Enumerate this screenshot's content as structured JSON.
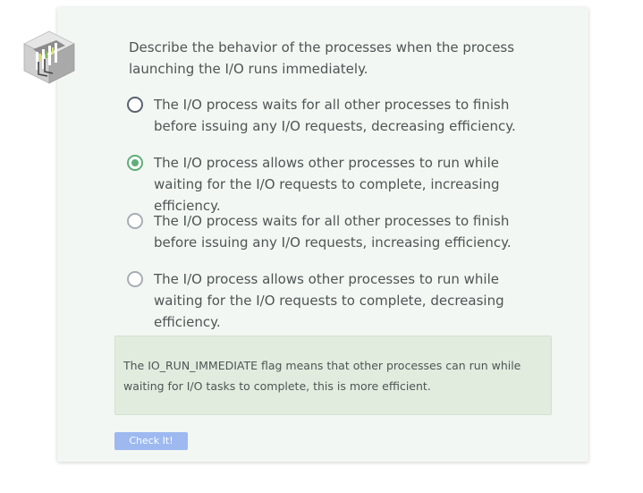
{
  "quiz": {
    "question": "Describe the behavior of the processes when the process launching the I/O runs immediately.",
    "options": [
      {
        "label": "The I/O process waits for all other processes to finish before issuing any I/O requests, decreasing efficiency.",
        "selected": false
      },
      {
        "label": "The I/O process allows other processes to run while waiting for the I/O requests to complete, increasing efficiency.",
        "selected": true
      },
      {
        "label": "The I/O process waits for all other processes to finish before issuing any I/O requests, increasing efficiency.",
        "selected": false
      },
      {
        "label": "The I/O process allows other processes to run while waiting for the I/O requests to complete, decreasing efficiency.",
        "selected": false
      }
    ],
    "feedback": "The IO_RUN_IMMEDIATE flag means that other processes can run while waiting for I/O tasks to complete, this is more efficient.",
    "check_button_label": "Check It!"
  },
  "icons": {
    "logo": "warehouse-cube-icon",
    "radio_selected": "radio-selected-icon",
    "radio_unselected": "radio-unselected-icon"
  },
  "colors": {
    "card_background": "#f2f7f3",
    "accent_green": "#5fae79",
    "feedback_background": "#e1ecdf",
    "button_background": "#9db9f0"
  }
}
